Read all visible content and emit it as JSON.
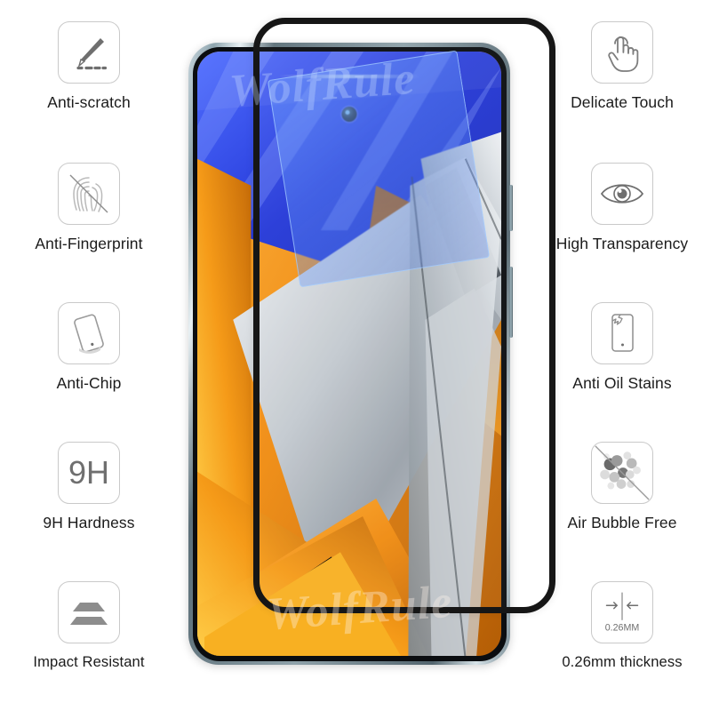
{
  "product": {
    "watermark": "WolfRule",
    "watermark_secondary": "WolfRule"
  },
  "features_left": [
    {
      "id": "anti-scratch",
      "icon": "scratch-blade-icon",
      "label": "Anti-scratch"
    },
    {
      "id": "anti-fingerprint",
      "icon": "fingerprint-icon",
      "label": "Anti-Fingerprint"
    },
    {
      "id": "anti-chip",
      "icon": "phone-tilt-icon",
      "label": "Anti-Chip"
    },
    {
      "id": "9h-hardness",
      "icon": "hardness-9h-icon",
      "label": "9H Hardness",
      "icon_text": "9H"
    },
    {
      "id": "impact-resistant",
      "icon": "impact-layers-icon",
      "label": "Impact Resistant"
    }
  ],
  "features_right": [
    {
      "id": "delicate-touch",
      "icon": "touch-hand-icon",
      "label": "Delicate Touch"
    },
    {
      "id": "high-transparency",
      "icon": "eye-icon",
      "label": "High Transparency"
    },
    {
      "id": "anti-oil-stains",
      "icon": "phone-crack-icon",
      "label": "Anti Oil Stains"
    },
    {
      "id": "air-bubble-free",
      "icon": "bubbles-icon",
      "label": "Air Bubble Free"
    },
    {
      "id": "thickness",
      "icon": "thickness-arrows-icon",
      "label": "0.26mm thickness",
      "icon_text": "0.26MM"
    }
  ],
  "colors": {
    "icon_border": "#c9c9c9",
    "icon_fill": "#6f6f6f",
    "label_text": "#1b1b1b",
    "glass_outline": "#161616",
    "film_blue": "#4a78f0",
    "wallpaper_orange": "#f5a623",
    "wallpaper_blue": "#2b4ae0",
    "wallpaper_silver": "#b9bfc6"
  }
}
